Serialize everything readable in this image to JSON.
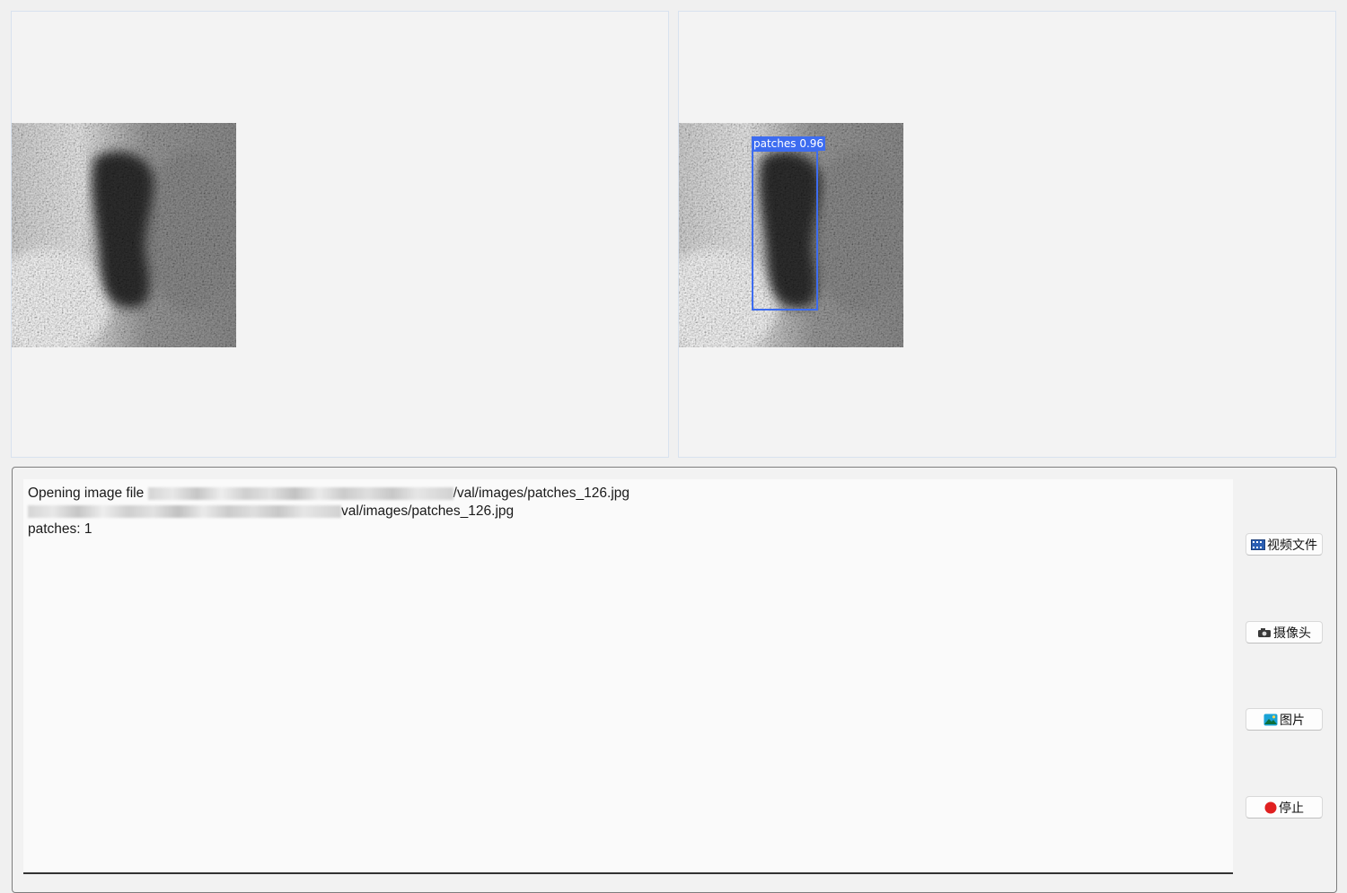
{
  "detection": {
    "label": "patches 0.96"
  },
  "log": {
    "line1_prefix": "Opening image file",
    "line1_suffix": "/val/images/patches_126.jpg",
    "line2_suffix": "val/images/patches_126.jpg",
    "line3": "patches: 1"
  },
  "buttons": {
    "video_file": {
      "label": "视频文件",
      "icon": "film-icon"
    },
    "camera": {
      "label": "摄像头",
      "icon": "camera-icon"
    },
    "image": {
      "label": "图片",
      "icon": "picture-icon"
    },
    "stop": {
      "label": "停止",
      "icon": "red-dot-icon",
      "color": "#e02020"
    }
  },
  "colors": {
    "detection_box": "#3d6cf0",
    "panel_bg": "#f3f3f3",
    "log_bg": "#fafafa"
  }
}
